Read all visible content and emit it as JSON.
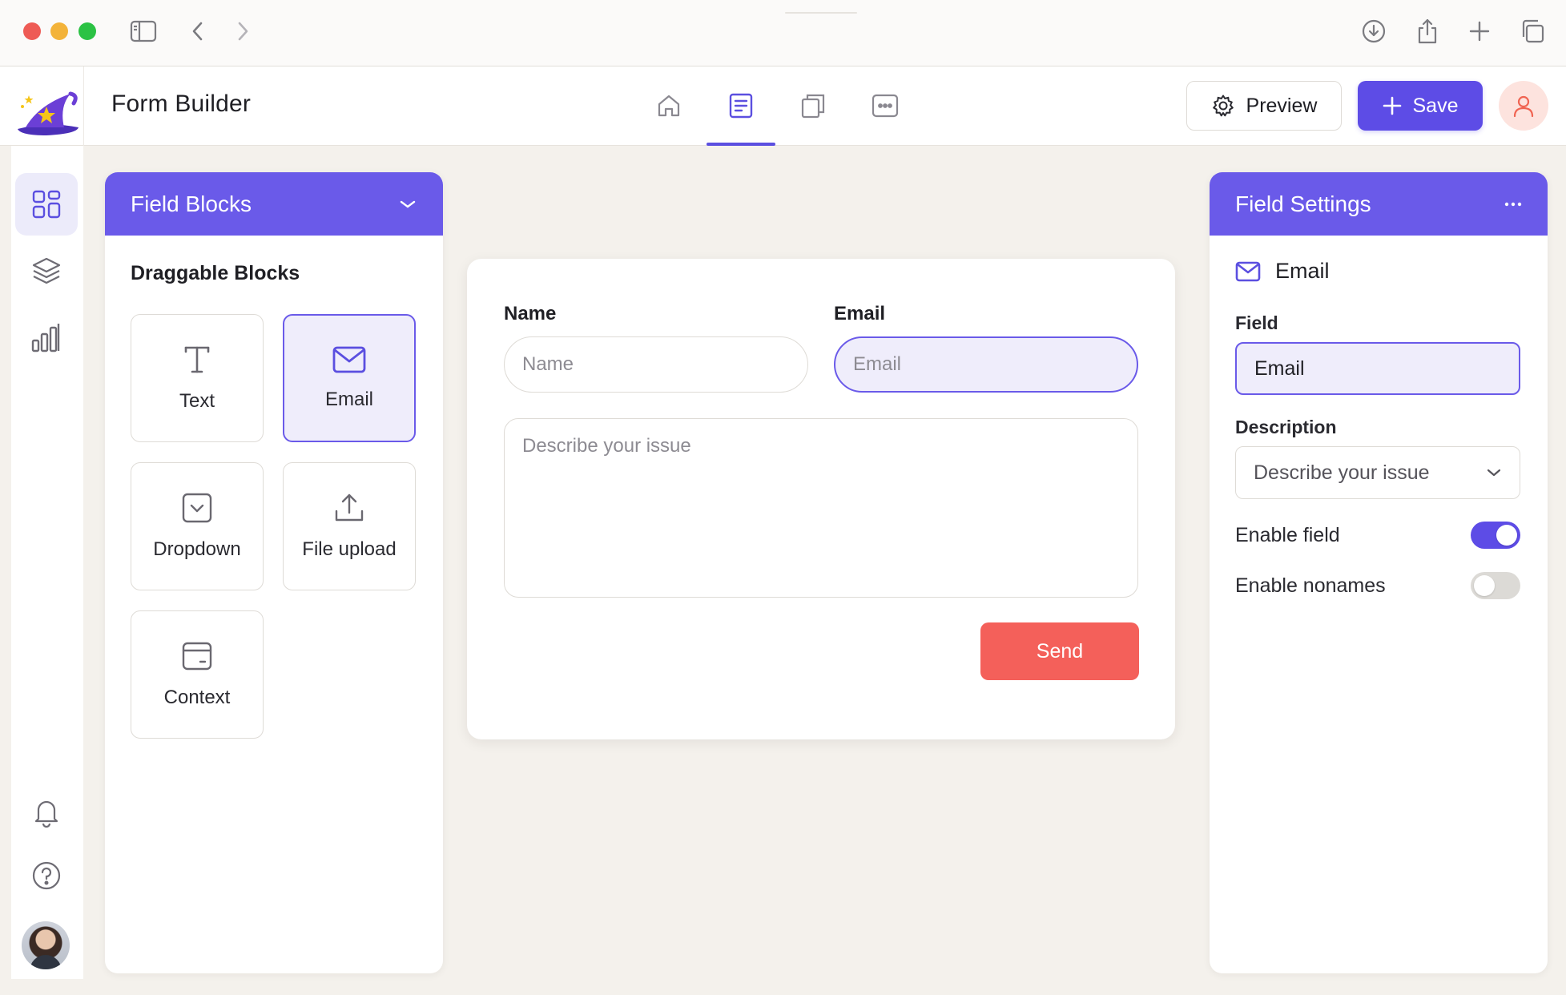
{
  "app": {
    "title": "Form Builder"
  },
  "header": {
    "preview_label": "Preview",
    "save_label": "Save",
    "nav_tabs": [
      "home",
      "form",
      "copy",
      "more"
    ],
    "active_tab": "form"
  },
  "rail": {
    "items": [
      "dashboard",
      "layers",
      "analytics"
    ],
    "active": "dashboard",
    "bottom": [
      "notifications",
      "help",
      "profile"
    ]
  },
  "left_panel": {
    "title": "Field Blocks",
    "section_title": "Draggable Blocks",
    "blocks": [
      {
        "label": "Text",
        "icon": "text-icon",
        "active": false
      },
      {
        "label": "Email",
        "icon": "mail-icon",
        "active": true
      },
      {
        "label": "Dropdown",
        "icon": "dropdown-icon",
        "active": false
      },
      {
        "label": "File upload",
        "icon": "upload-icon",
        "active": false
      },
      {
        "label": "Context",
        "icon": "window-icon",
        "active": false
      }
    ]
  },
  "form": {
    "name_label": "Name",
    "name_placeholder": "Name",
    "email_label": "Email",
    "email_placeholder": "Email",
    "textarea_placeholder": "Describe your issue",
    "send_label": "Send"
  },
  "right_panel": {
    "title": "Field Settings",
    "field_type": "Email",
    "field_label": "Field",
    "field_value": "Email",
    "description_label": "Description",
    "description_value": "Describe your issue",
    "toggles": [
      {
        "label": "Enable field",
        "on": true
      },
      {
        "label": "Enable nonames",
        "on": false
      }
    ]
  },
  "colors": {
    "accent": "#5d4ce6",
    "panel_header": "#6a5ae9",
    "send": "#f4605a",
    "background": "#f4f1ec"
  }
}
